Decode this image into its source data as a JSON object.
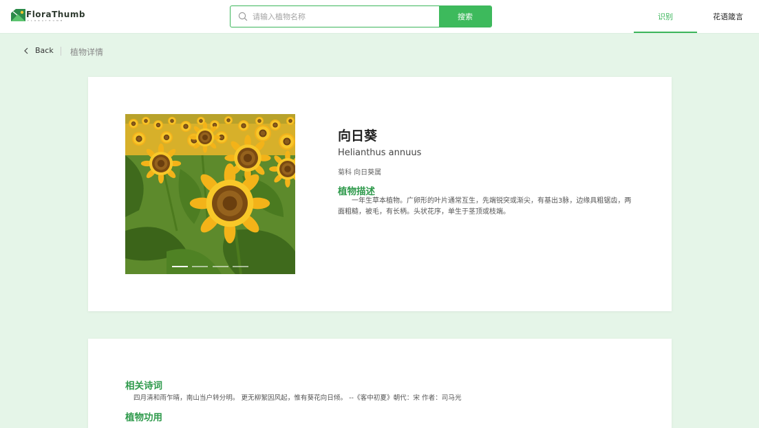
{
  "header": {
    "logo_text": "FloraThumb",
    "logo_sub": "FLORATHUMB",
    "search": {
      "placeholder": "请输入植物名称",
      "value": "",
      "button_label": "搜索"
    },
    "nav": [
      {
        "label": "识别",
        "active": true
      },
      {
        "label": "花语箴言",
        "active": false
      }
    ]
  },
  "breadcrumb": {
    "back_label": "Back",
    "current": "植物详情"
  },
  "plant": {
    "name": "向日葵",
    "latin_name": "Helianthus annuus",
    "family": "菊科 向日葵属",
    "description_title": "植物描述",
    "description": "一年生草本植物。广卵形的叶片通常互生，先端锐突或渐尖，有基出3脉，边缘具粗锯齿，两面粗糙，被毛，有长柄。头状花序，单生于茎顶或枝端。",
    "gallery": {
      "slide_count": 4,
      "active_index": 0
    }
  },
  "extra": {
    "poem_title": "相关诗词",
    "poem_text": "四月清和雨乍晴，南山当户转分明。 更无柳絮因风起，惟有葵花向日倾。 --《客中初夏》朝代：宋 作者：司马光",
    "use_title": "植物功用"
  },
  "colors": {
    "accent": "#3bb55a",
    "section_title": "#2f9a4c",
    "page_bg": "#e5f5e8"
  }
}
